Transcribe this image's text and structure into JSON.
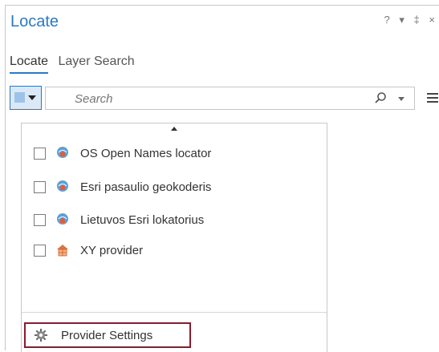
{
  "window": {
    "title": "Locate",
    "controls": [
      "?",
      "▾",
      "‡",
      "×"
    ]
  },
  "tabs": [
    {
      "label": "Locate",
      "active": true
    },
    {
      "label": "Layer Search",
      "active": false
    }
  ],
  "search": {
    "placeholder": "Search",
    "value": ""
  },
  "providers": [
    {
      "label": "OS Open Names locator",
      "checked": false,
      "icon": "locator-globe-icon"
    },
    {
      "label": "Esri pasaulio geokoderis",
      "checked": false,
      "icon": "locator-globe-icon"
    },
    {
      "label": "Lietuvos Esri lokatorius",
      "checked": false,
      "icon": "locator-globe-icon"
    },
    {
      "label": "XY provider",
      "checked": false,
      "icon": "xy-provider-icon"
    }
  ],
  "footer": {
    "settings_label": "Provider Settings"
  },
  "colors": {
    "accent": "#2b79c2",
    "highlight_border": "#8b1a2b"
  }
}
